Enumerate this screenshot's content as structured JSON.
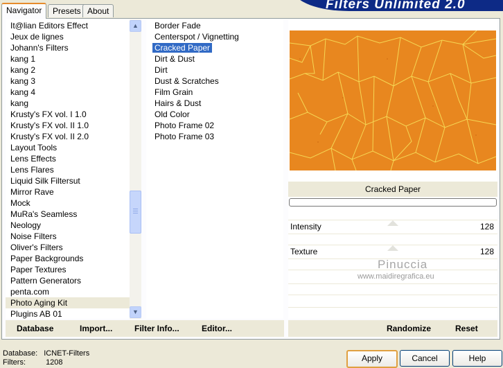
{
  "title": "Filters Unlimited 2.0",
  "tabs": [
    "Navigator",
    "Presets",
    "About"
  ],
  "categories": [
    "It@lian Editors Effect",
    "Jeux de lignes",
    "Johann's Filters",
    "kang 1",
    "kang 2",
    "kang 3",
    "kang 4",
    "kang",
    "Krusty's FX vol. I 1.0",
    "Krusty's FX vol. II 1.0",
    "Krusty's FX vol. II 2.0",
    "Layout Tools",
    "Lens Effects",
    "Lens Flares",
    "Liquid Silk Filtersut",
    "Mirror Rave",
    "Mock",
    "MuRa's Seamless",
    "Neology",
    "Noise Filters",
    "Oliver's Filters",
    "Paper Backgrounds",
    "Paper Textures",
    "Pattern Generators",
    "penta.com",
    "Photo Aging Kit",
    "Plugins AB 01"
  ],
  "selected_category": "Photo Aging Kit",
  "filters": [
    "Border Fade",
    "Centerspot / Vignetting",
    "Cracked Paper",
    "Dirt & Dust",
    "Dirt",
    "Dust & Scratches",
    "Film Grain",
    "Hairs & Dust",
    "Old Color",
    "Photo Frame 02",
    "Photo Frame 03"
  ],
  "selected_filter": "Cracked Paper",
  "preview": {
    "filter_name": "Cracked Paper",
    "texture_color": "#e8871f",
    "crack_color": "#f7e05a"
  },
  "params": [
    {
      "label": "Intensity",
      "value": "128"
    },
    {
      "label": "Texture",
      "value": "128"
    }
  ],
  "watermark": {
    "name": "Pinuccia",
    "url": "www.maidiregrafica.eu"
  },
  "toolbar_left": {
    "database": "Database",
    "import": "Import...",
    "filter_info": "Filter Info...",
    "editor": "Editor..."
  },
  "toolbar_right": {
    "randomize": "Randomize",
    "reset": "Reset"
  },
  "status": {
    "database_label": "Database:",
    "database_value": "ICNET-Filters",
    "filters_label": "Filters:",
    "filters_value": "1208"
  },
  "buttons": {
    "apply": "Apply",
    "cancel": "Cancel",
    "help": "Help"
  },
  "colors": {
    "accent": "#316ac5",
    "banner": "#0d2a86",
    "window": "#ece9d8"
  }
}
